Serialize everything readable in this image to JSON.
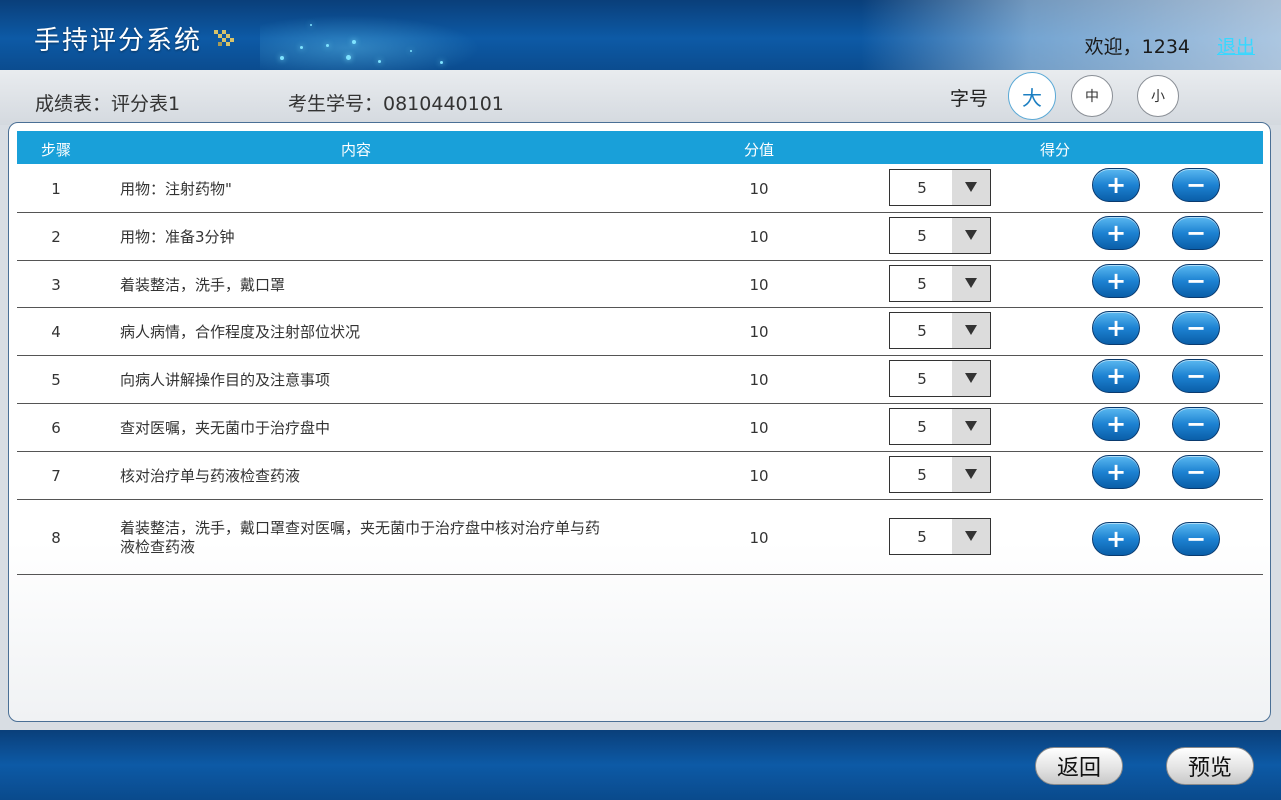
{
  "header": {
    "app_title": "手持评分系统",
    "welcome_text": "欢迎，1234",
    "logout_label": "退出"
  },
  "subheader": {
    "sheet_label": "成绩表：评分表1",
    "student_label": "考生学号：0810440101",
    "font_size_label": "字号",
    "font_sizes": {
      "large": "大",
      "medium": "中",
      "small": "小"
    }
  },
  "table": {
    "columns": {
      "step": "步骤",
      "content": "内容",
      "score": "分值",
      "earned": "得分"
    },
    "rows": [
      {
        "step": "1",
        "content": "用物：注射药物\"",
        "score": "10",
        "earned": "5"
      },
      {
        "step": "2",
        "content": "用物：准备3分钟",
        "score": "10",
        "earned": "5"
      },
      {
        "step": "3",
        "content": "着装整洁，洗手，戴口罩",
        "score": "10",
        "earned": "5"
      },
      {
        "step": "4",
        "content": "病人病情，合作程度及注射部位状况",
        "score": "10",
        "earned": "5"
      },
      {
        "step": "5",
        "content": "向病人讲解操作目的及注意事项",
        "score": "10",
        "earned": "5"
      },
      {
        "step": "6",
        "content": "查对医嘱，夹无菌巾于治疗盘中",
        "score": "10",
        "earned": "5"
      },
      {
        "step": "7",
        "content": "核对治疗单与药液检查药液",
        "score": "10",
        "earned": "5"
      },
      {
        "step": "8",
        "content": "着装整洁，洗手，戴口罩查对医嘱，夹无菌巾于治疗盘中核对治疗单与药液检查药液",
        "score": "10",
        "earned": "5"
      }
    ],
    "plus_label": "+",
    "minus_label": "−"
  },
  "footer": {
    "back_label": "返回",
    "preview_label": "预览"
  },
  "colors": {
    "header_blue": "#0d5aa6",
    "table_header": "#19a0d9",
    "logout_link": "#38d8ff",
    "button_blue": "#1d82d2"
  },
  "icons": {
    "title_decoration": "checker-icon",
    "dropdown_arrow": "triangle-down-icon"
  }
}
